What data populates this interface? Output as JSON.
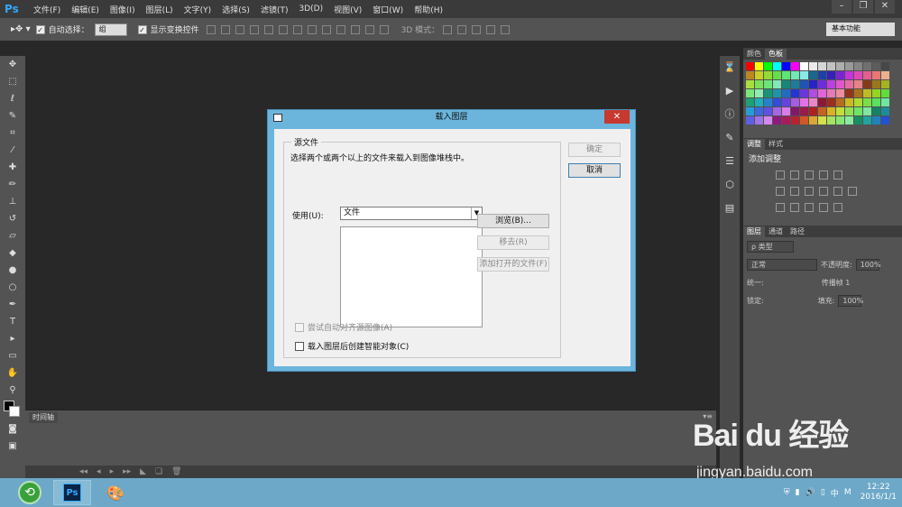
{
  "app": {
    "logo": "Ps"
  },
  "menu": [
    "文件(F)",
    "编辑(E)",
    "图像(I)",
    "图层(L)",
    "文字(Y)",
    "选择(S)",
    "滤镜(T)",
    "3D(D)",
    "视图(V)",
    "窗口(W)",
    "帮助(H)"
  ],
  "options": {
    "auto_select_label": "自动选择：",
    "auto_select_value": "组",
    "show_transform_label": "显示变换控件",
    "mode3d_label": "3D 模式：",
    "workspace": "基本功能"
  },
  "timeline": {
    "tab": "时间轴"
  },
  "panels": {
    "swatch_tabs": [
      "颜色",
      "色板"
    ],
    "adjust_tabs": [
      "调整",
      "样式"
    ],
    "adjust_title": "添加调整",
    "layer_tabs": [
      "图层",
      "通道",
      "路径"
    ],
    "kind_label": "ρ 类型",
    "blend_mode": "正常",
    "opacity_label": "不透明度:",
    "opacity_value": "100%",
    "unify_label": "统一:",
    "propagate_label": "传播帧 1",
    "lock_label": "锁定:",
    "fill_label": "填充:",
    "fill_value": "100%",
    "colors": [
      "#ff0000",
      "#ffff00",
      "#00ff00",
      "#00ffff",
      "#0000ff",
      "#ff00ff",
      "#ffffff",
      "#ebebeb",
      "#d6d6d6",
      "#c2c2c2",
      "#adadad",
      "#999999",
      "#858585",
      "#707070",
      "#5c5c5c",
      "#474747"
    ]
  },
  "dialog": {
    "title": "载入图层",
    "group_label": "源文件",
    "description": "选择两个或两个以上的文件来载入到图像堆栈中。",
    "use_label": "使用(U):",
    "use_value": "文件",
    "browse": "浏览(B)...",
    "remove": "移去(R)",
    "add_open": "添加打开的文件(F)",
    "auto_align": "尝试自动对齐源图像(A)",
    "smart_object": "载入图层后创建智能对象(C)",
    "ok": "确定",
    "cancel": "取消"
  },
  "taskbar": {
    "ps_label": "Ps",
    "ime": "中",
    "time": "12:22",
    "date": "2016/1/1"
  },
  "watermark": {
    "brand": "Bai du 经验",
    "url": "jingyan.baidu.com"
  }
}
